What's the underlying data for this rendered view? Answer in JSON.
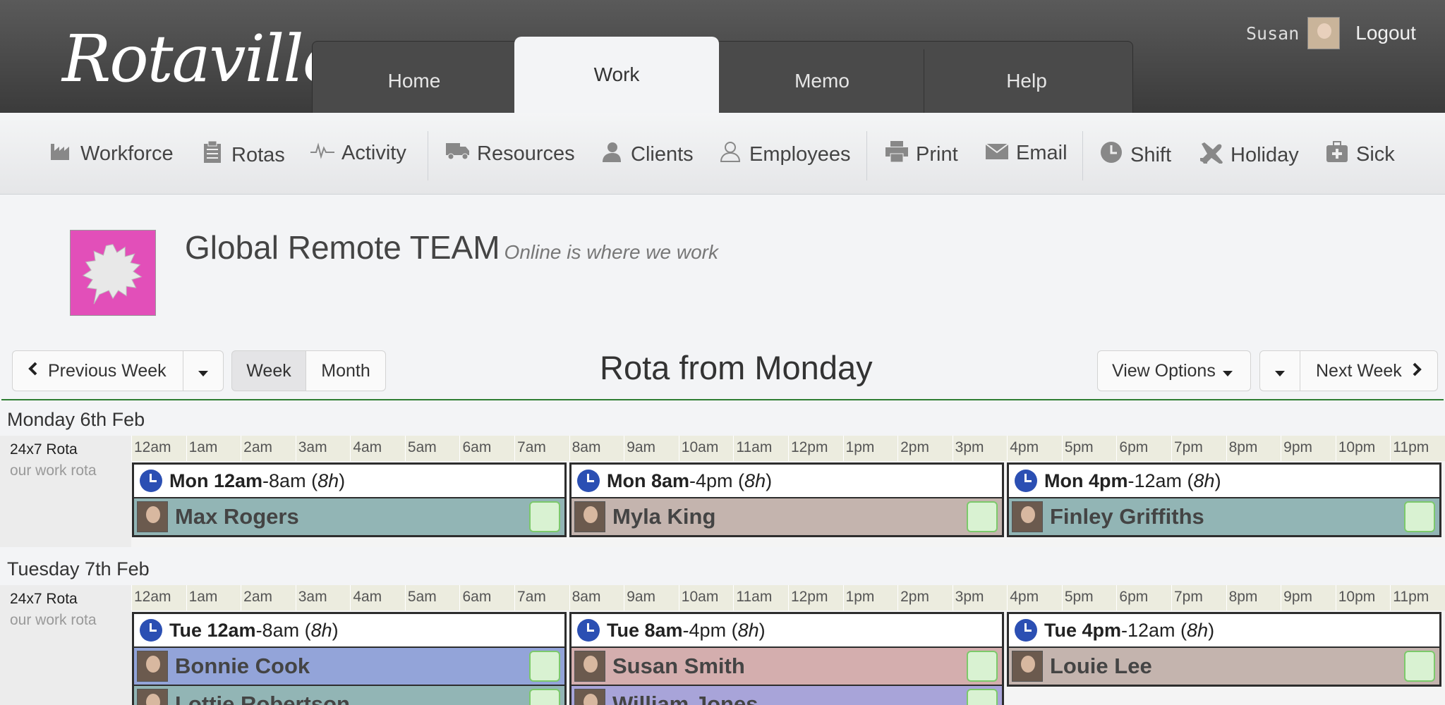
{
  "app": {
    "logo": "Rotaville",
    "user_name": "Susan",
    "logout": "Logout"
  },
  "tabs": [
    {
      "label": "Home"
    },
    {
      "label": "Work",
      "active": true
    },
    {
      "label": "Memo"
    },
    {
      "label": "Help"
    }
  ],
  "toolbar": {
    "workforce": "Workforce",
    "rotas": "Rotas",
    "activity": "Activity",
    "resources": "Resources",
    "clients": "Clients",
    "employees": "Employees",
    "print": "Print",
    "email": "Email",
    "shift": "Shift",
    "holiday": "Holiday",
    "sick": "Sick"
  },
  "team": {
    "name": "Global Remote TEAM",
    "tagline": "Online is where we work"
  },
  "nav": {
    "previous_week": "Previous Week",
    "week": "Week",
    "month": "Month",
    "title": "Rota from Monday",
    "view_options": "View Options",
    "next_week": "Next Week"
  },
  "hours": [
    "12am",
    "1am",
    "2am",
    "3am",
    "4am",
    "5am",
    "6am",
    "7am",
    "8am",
    "9am",
    "10am",
    "11am",
    "12pm",
    "1pm",
    "2pm",
    "3pm",
    "4pm",
    "5pm",
    "6pm",
    "7pm",
    "8pm",
    "9pm",
    "10pm",
    "11pm"
  ],
  "rota": {
    "name": "24x7 Rota",
    "description": "our work rota"
  },
  "days": [
    {
      "title": "Monday 6th Feb",
      "shifts": [
        {
          "start": "Mon 12am",
          "end": "-8am (",
          "dur": "8h",
          "close": ")",
          "employee": "Max Rogers",
          "color": "#92b5b5"
        },
        {
          "start": "Mon 8am",
          "end": "-4pm (",
          "dur": "8h",
          "close": ")",
          "employee": "Myla King",
          "color": "#c4b4ae"
        },
        {
          "start": "Mon 4pm",
          "end": "-12am (",
          "dur": "8h",
          "close": ")",
          "employee": "Finley Griffiths",
          "color": "#92b5b5"
        }
      ]
    },
    {
      "title": "Tuesday 7th Feb",
      "shifts": [
        {
          "start": "Tue 12am",
          "end": "-8am (",
          "dur": "8h",
          "close": ")",
          "employee": "Bonnie Cook",
          "color": "#93a4d9"
        },
        {
          "start": "Tue 8am",
          "end": "-4pm (",
          "dur": "8h",
          "close": ")",
          "employee": "Susan Smith",
          "color": "#d4aeae"
        },
        {
          "start": "Tue 4pm",
          "end": "-12am (",
          "dur": "8h",
          "close": ")",
          "employee": "Louie Lee",
          "color": "#c4b4ae"
        }
      ],
      "extra_employees": [
        {
          "employee": "Lottie Robertson",
          "color": "#92b5b5"
        },
        {
          "employee": "William Jones",
          "color": "#a8a4d9"
        }
      ]
    }
  ]
}
